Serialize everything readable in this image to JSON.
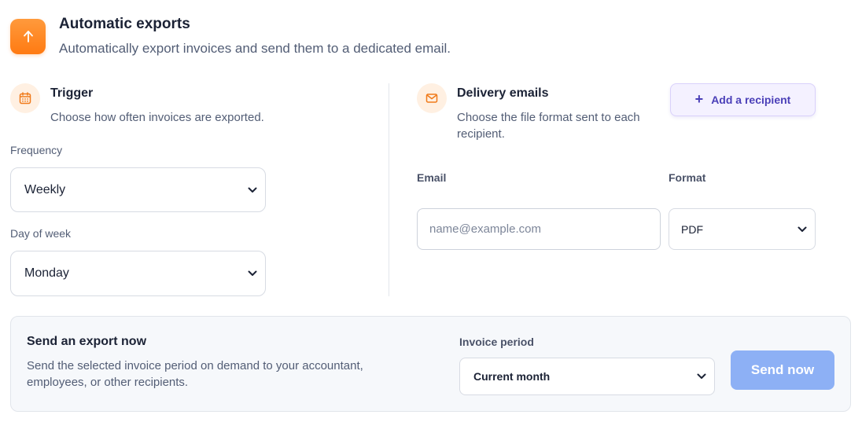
{
  "header": {
    "title": "Automatic exports",
    "subtitle": "Automatically export invoices and send them to a dedicated email.",
    "icon": "upload-arrow-icon"
  },
  "trigger": {
    "title": "Trigger",
    "description": "Choose how often invoices are exported.",
    "icon": "calendar-icon",
    "frequency_label": "Frequency",
    "frequency_value": "Weekly",
    "day_label": "Day of week",
    "day_value": "Monday"
  },
  "delivery": {
    "title": "Delivery emails",
    "description_line1": "Choose the file format sent to each",
    "description_line2": "recipient.",
    "icon": "mail-icon",
    "add_recipient_label": "Add a recipient",
    "email_label": "Email",
    "email_placeholder": "name@example.com",
    "format_label": "Format",
    "format_value": "PDF"
  },
  "export_now": {
    "title": "Send an export now",
    "description_line1": "Send the selected invoice period on demand to your accountant,",
    "description_line2": "employees, or other recipients.",
    "period_label": "Invoice period",
    "period_value": "Current month",
    "send_label": "Send now"
  },
  "colors": {
    "accent_orange": "#ff7a12",
    "accent_purple": "#4a3fb8",
    "send_button": "#8db0f5"
  }
}
